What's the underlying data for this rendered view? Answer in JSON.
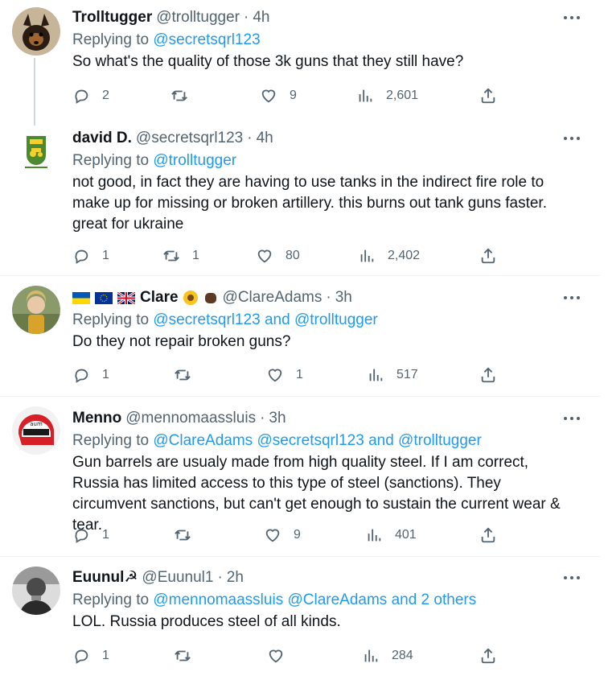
{
  "tweets": [
    {
      "name": "Trolltugger",
      "handle": "@trolltugger",
      "time": "4h",
      "replying_label": "Replying to",
      "replying_to": "@secretsqrl123",
      "text": "So what's the quality of those 3k guns that they still have?",
      "replies": "2",
      "retweets": "",
      "likes": "9",
      "views": "2,601"
    },
    {
      "name": "david D.",
      "handle": "@secretsqrl123",
      "time": "4h",
      "replying_label": "Replying to",
      "replying_to": "@trolltugger",
      "text": "not good, in fact they are having to use tanks in the indirect fire role to make up for missing or broken artillery.  this burns out tank guns faster. great for ukraine",
      "replies": "1",
      "retweets": "1",
      "likes": "80",
      "views": "2,402"
    },
    {
      "name": "Clare",
      "handle": "@ClareAdams",
      "time": "3h",
      "replying_label": "Replying to",
      "replying_to": "@secretsqrl123 and @trolltugger",
      "text": "Do they not repair broken guns?",
      "replies": "1",
      "retweets": "",
      "likes": "1",
      "views": "517"
    },
    {
      "name": "Menno",
      "handle": "@mennomaassluis",
      "time": "3h",
      "replying_label": "Replying to",
      "replying_to": "@ClareAdams @secretsqrl123 and @trolltugger",
      "text": "Gun barrels are usualy made from high quality steel. If I am correct, Russia has limited access to this type of steel (sanctions). They circumvent sanctions, but can't get enough to sustain the current wear & tear.",
      "replies": "1",
      "retweets": "",
      "likes": "9",
      "views": "401"
    },
    {
      "name": "Euunul☭",
      "handle": "@Euunul1",
      "time": "2h",
      "replying_label": "Replying to",
      "replying_to": "@mennomaassluis @ClareAdams and 2 others",
      "text": "LOL. Russia produces steel of all kinds.",
      "replies": "1",
      "retweets": "",
      "likes": "",
      "views": "284"
    }
  ],
  "separator": "·",
  "colors": {
    "link": "#1d9bf0",
    "secondary": "#536471",
    "text": "#0f1419",
    "divider": "#eff3f4",
    "thread_line": "#cfd9de"
  },
  "icons": {
    "more": "more-dots-icon",
    "reply": "reply-icon",
    "retweet": "retweet-icon",
    "like": "heart-icon",
    "views": "views-chart-icon",
    "share": "share-icon"
  }
}
